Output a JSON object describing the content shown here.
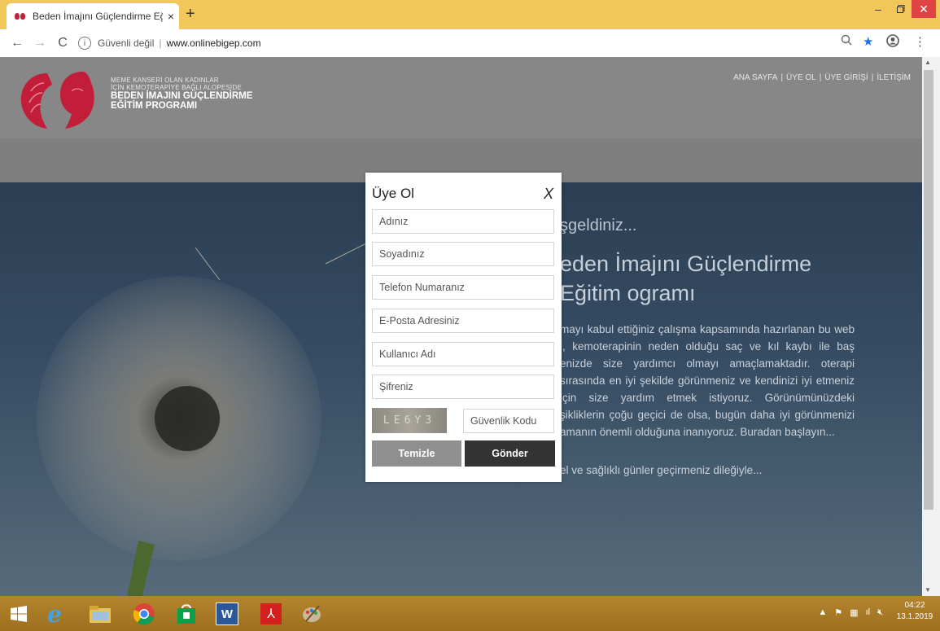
{
  "browser": {
    "tab_title": "Beden İmajını Güçlendirme Eğitim",
    "tab_close": "×",
    "new_tab": "+",
    "security_label": "Güvenli değil",
    "url": "www.onlinebigep.com"
  },
  "site": {
    "logo_lines_small": [
      "MEME KANSERİ OLAN KADINLAR",
      "İÇİN KEMOTERAPİYE BAĞLI ALOPESİDE"
    ],
    "logo_lines_big": [
      "BEDEN İMAJINI GÜÇLENDİRME",
      "EĞİTİM PROGRAMI"
    ],
    "nav": [
      "ANA SAYFA",
      "ÜYE OL",
      "ÜYE GİRİŞİ",
      "İLETİŞİM"
    ],
    "nav_separator": "|"
  },
  "hero": {
    "welcome": "şgeldiniz...",
    "heading": "eden İmajını Güçlendirme Eğitim ogramı",
    "paragraph": "mayı kabul ettiğiniz çalışma kapsamında hazırlanan bu web i, kemoterapinin neden olduğu saç ve kıl kaybı ile baş enizde size yardımcı olmayı amaçlamaktadır. oterapi sırasında en iyi şekilde görünmeniz ve kendinizi iyi etmeniz için size yardım etmek istiyoruz. Görünümünüzdeki şikliklerin çoğu geçici de olsa, bugün daha iyi görünmenizi amanın önemli olduğuna inanıyoruz. Buradan başlayın...",
    "closing": "el ve sağlıklı günler geçirmeniz dileğiyle..."
  },
  "modal": {
    "title": "Üye Ol",
    "close": "X",
    "fields": {
      "name": "Adınız",
      "surname": "Soyadınız",
      "phone": "Telefon Numaranız",
      "email": "E-Posta Adresiniz",
      "username": "Kullanıcı Adı",
      "password": "Şifreniz",
      "security": "Güvenlik Kodu"
    },
    "captcha_text": "LE6Y3",
    "clear_label": "Temizle",
    "send_label": "Gönder"
  },
  "taskbar": {
    "time": "04:22",
    "date": "13.1.2019"
  },
  "colors": {
    "accent": "#c21e3a",
    "send_button": "#333333",
    "clear_button": "#8f8f8f",
    "tab_strip": "#f1c75a"
  }
}
